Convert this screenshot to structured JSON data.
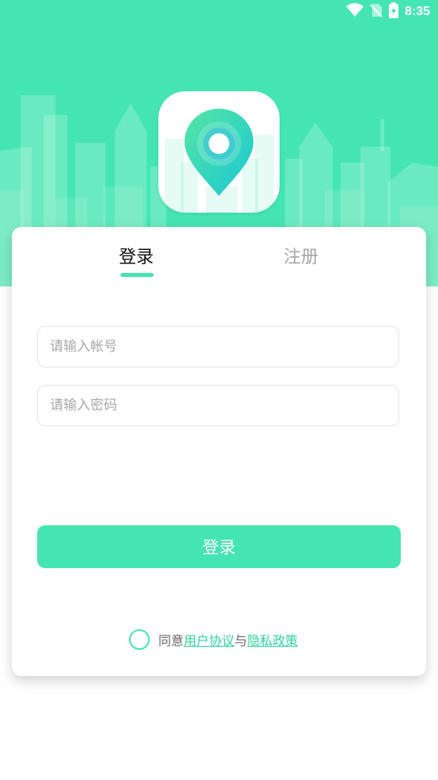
{
  "status_bar": {
    "time": "8:35",
    "icons": [
      "wifi-icon",
      "no-sim-icon",
      "battery-charging-icon"
    ]
  },
  "app": {
    "logo_icon": "location-pin-icon"
  },
  "tabs": [
    {
      "label": "登录",
      "active": true
    },
    {
      "label": "注册",
      "active": false
    }
  ],
  "form": {
    "account_placeholder": "请输入帐号",
    "account_value": "",
    "password_placeholder": "请输入密码",
    "password_value": "",
    "submit_label": "登录"
  },
  "agreement": {
    "checked": false,
    "prefix": "同意",
    "user_agreement": "用户协议",
    "connector": "与",
    "privacy_policy": "隐私政策"
  },
  "colors": {
    "accent": "#45e5b1",
    "link": "#2ed3a0",
    "tab_inactive": "#a6a6a6"
  }
}
